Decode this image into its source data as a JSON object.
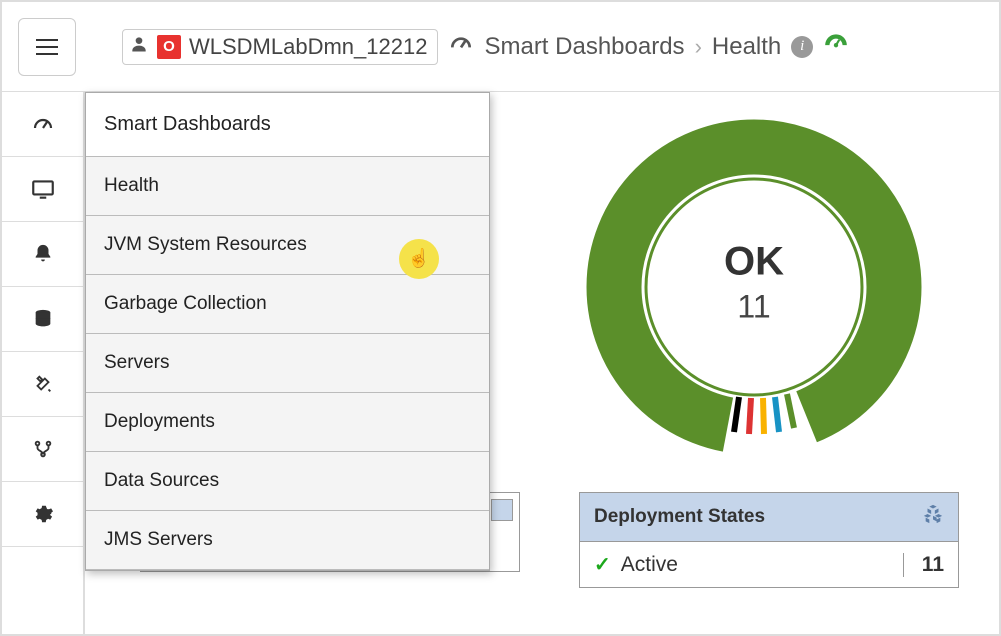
{
  "header": {
    "domain_name": "WLSDMLabDmn_12212",
    "breadcrumb_section": "Smart Dashboards",
    "breadcrumb_page": "Health"
  },
  "flyout": {
    "title": "Smart Dashboards",
    "items": [
      "Health",
      "JVM System Resources",
      "Garbage Collection",
      "Servers",
      "Deployments",
      "Data Sources",
      "JMS Servers"
    ]
  },
  "donut": {
    "status_label": "OK",
    "count": "11"
  },
  "deployment_panel": {
    "title": "Deployment States",
    "row_label": "Active",
    "row_value": "11"
  },
  "chart_data": {
    "type": "pie",
    "title": "Health",
    "series": [
      {
        "name": "OK",
        "values": [
          11
        ],
        "color": "#5b8f2a"
      }
    ],
    "total": 11,
    "center_label": "OK",
    "center_value": 11
  }
}
